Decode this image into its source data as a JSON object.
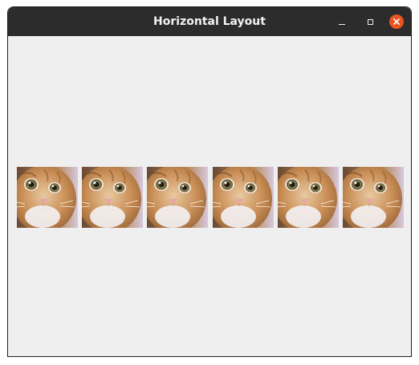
{
  "window": {
    "title": "Horizontal Layout"
  },
  "titlebar_controls": {
    "minimize_icon": "minimize-icon",
    "maximize_icon": "maximize-icon",
    "close_icon": "close-icon",
    "close_color": "#e95420"
  },
  "images": [
    {
      "subject": "orange tabby cat face"
    },
    {
      "subject": "orange tabby cat face"
    },
    {
      "subject": "orange tabby cat face"
    },
    {
      "subject": "orange tabby cat face"
    },
    {
      "subject": "orange tabby cat face"
    },
    {
      "subject": "orange tabby cat face"
    }
  ]
}
